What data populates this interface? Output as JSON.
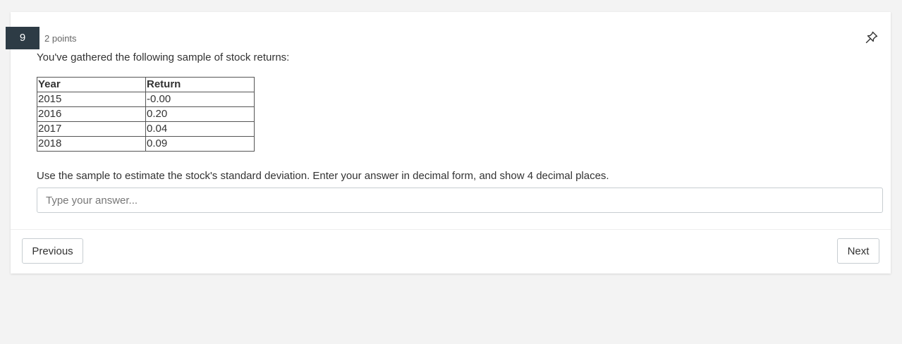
{
  "question": {
    "number": "9",
    "points": "2 points",
    "prompt": "You've gathered the following sample of stock returns:",
    "instructions": "Use the sample to estimate the stock's standard deviation. Enter your answer in decimal form, and show 4 decimal places."
  },
  "table": {
    "headers": [
      "Year",
      "Return"
    ],
    "rows": [
      [
        "2015",
        "-0.00"
      ],
      [
        "2016",
        "0.20"
      ],
      [
        "2017",
        "0.04"
      ],
      [
        "2018",
        "0.09"
      ]
    ]
  },
  "answer": {
    "value": "",
    "placeholder": "Type your answer..."
  },
  "nav": {
    "previous_label": "Previous",
    "next_label": "Next"
  },
  "icons": {
    "pin": "pin-icon"
  },
  "colors": {
    "question_badge": "#2d3b45",
    "page_background": "#f3f3f3"
  }
}
